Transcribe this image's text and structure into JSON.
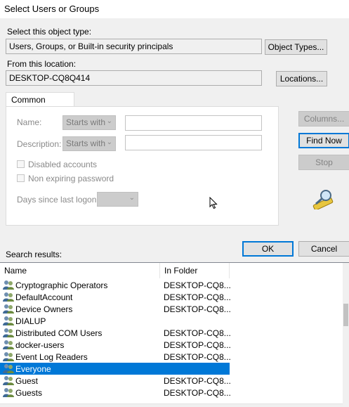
{
  "window": {
    "title": "Select Users or Groups"
  },
  "object_type": {
    "label": "Select this object type:",
    "value": "Users, Groups, or Built-in security principals",
    "button": "Object Types..."
  },
  "location": {
    "label": "From this location:",
    "value": "DESKTOP-CQ8Q414",
    "button": "Locations..."
  },
  "common_queries": {
    "tab": "Common Queries",
    "name_label": "Name:",
    "name_mode": "Starts with",
    "description_label": "Description:",
    "description_mode": "Starts with",
    "disabled_accounts": "Disabled accounts",
    "non_expiring_password": "Non expiring password",
    "days_label": "Days since last logon:"
  },
  "side_buttons": {
    "columns": "Columns...",
    "find_now": "Find Now",
    "stop": "Stop"
  },
  "dialog_buttons": {
    "ok": "OK",
    "cancel": "Cancel"
  },
  "results": {
    "label": "Search results:",
    "columns": [
      "Name",
      "In Folder"
    ],
    "rows": [
      {
        "name": "Cryptographic Operators",
        "folder": "DESKTOP-CQ8..."
      },
      {
        "name": "DefaultAccount",
        "folder": "DESKTOP-CQ8..."
      },
      {
        "name": "Device Owners",
        "folder": "DESKTOP-CQ8..."
      },
      {
        "name": "DIALUP",
        "folder": ""
      },
      {
        "name": "Distributed COM Users",
        "folder": "DESKTOP-CQ8..."
      },
      {
        "name": "docker-users",
        "folder": "DESKTOP-CQ8..."
      },
      {
        "name": "Event Log Readers",
        "folder": "DESKTOP-CQ8..."
      },
      {
        "name": "Everyone",
        "folder": "",
        "selected": true
      },
      {
        "name": "Guest",
        "folder": "DESKTOP-CQ8..."
      },
      {
        "name": "Guests",
        "folder": "DESKTOP-CQ8..."
      }
    ]
  },
  "colors": {
    "selection": "#0078d7",
    "default_button_border": "#0078d7"
  }
}
